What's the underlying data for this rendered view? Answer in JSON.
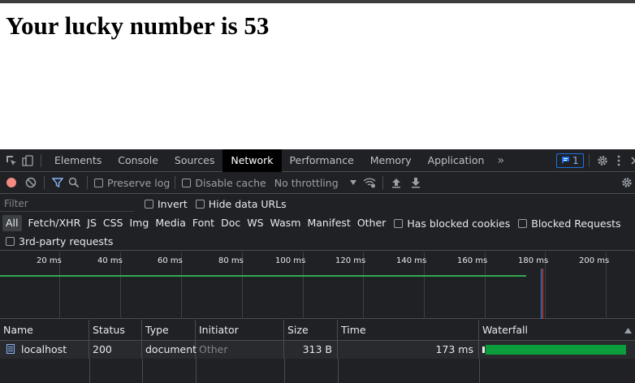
{
  "page": {
    "heading": "Your lucky number is 53"
  },
  "devtools": {
    "tabs": [
      "Elements",
      "Console",
      "Sources",
      "Network",
      "Performance",
      "Memory",
      "Application"
    ],
    "active_tab": "Network",
    "more_tabs": "»",
    "issues_count": "1",
    "toolbar": {
      "preserve_log": "Preserve log",
      "disable_cache": "Disable cache",
      "throttling": "No throttling"
    },
    "filter": {
      "placeholder": "Filter",
      "invert": "Invert",
      "hide_data_urls": "Hide data URLs"
    },
    "types": [
      "All",
      "Fetch/XHR",
      "JS",
      "CSS",
      "Img",
      "Media",
      "Font",
      "Doc",
      "WS",
      "Wasm",
      "Manifest",
      "Other"
    ],
    "has_blocked_cookies": "Has blocked cookies",
    "blocked_requests": "Blocked Requests",
    "third_party": "3rd-party requests",
    "timeline_ticks": [
      "20 ms",
      "40 ms",
      "60 ms",
      "80 ms",
      "100 ms",
      "120 ms",
      "140 ms",
      "160 ms",
      "180 ms",
      "200 ms"
    ],
    "columns": {
      "name": "Name",
      "status": "Status",
      "type": "Type",
      "initiator": "Initiator",
      "size": "Size",
      "time": "Time",
      "waterfall": "Waterfall"
    },
    "requests": [
      {
        "name": "localhost",
        "status": "200",
        "type": "document",
        "initiator": "Other",
        "size": "313 B",
        "time": "173 ms"
      }
    ]
  }
}
